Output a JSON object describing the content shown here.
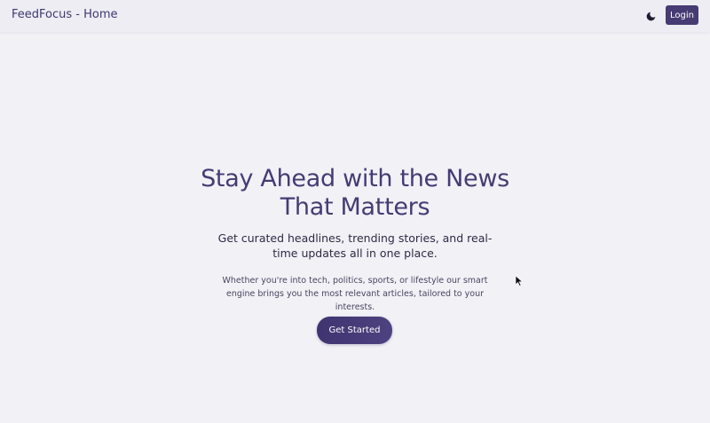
{
  "header": {
    "title": "FeedFocus - Home",
    "theme_toggle_icon": "moon-icon",
    "login_label": "Login"
  },
  "hero": {
    "title": "Stay Ahead with the News That Matters",
    "subtitle": "Get curated headlines, trending stories, and real-time updates all in one place.",
    "description": "Whether you're into tech, politics, sports, or lifestyle our smart engine brings you the most relevant articles, tailored to your interests.",
    "cta_label": "Get Started"
  },
  "colors": {
    "accent": "#463b73",
    "background": "#f1f1f6"
  }
}
